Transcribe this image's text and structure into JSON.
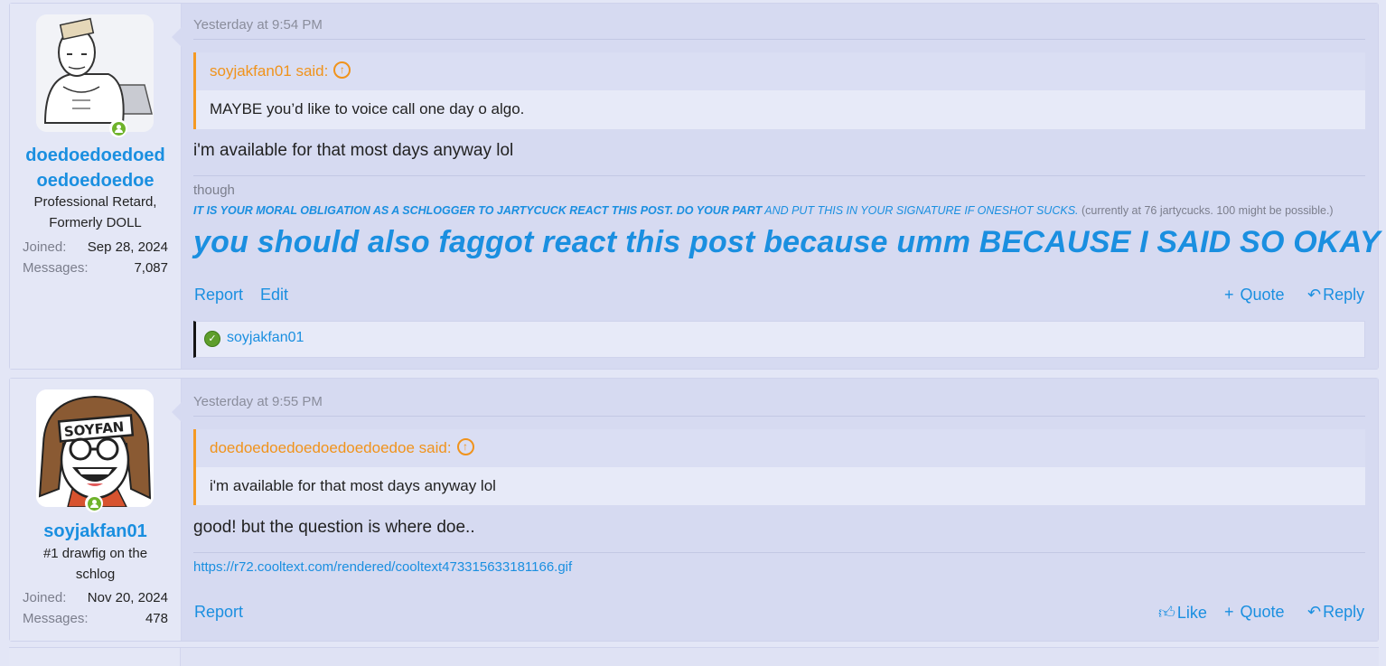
{
  "posts": [
    {
      "username_line1": "doedoedoedoed",
      "username_line2": "oedoedoedoe",
      "user_title_line1": "Professional Retard,",
      "user_title_line2": "Formerly DOLL",
      "joined_label": "Joined:",
      "joined_value": "Sep 28, 2024",
      "messages_label": "Messages:",
      "messages_value": "7,087",
      "date": "Yesterday at 9:54 PM",
      "quote_author": "soyjakfan01 said:",
      "quote_text": "MAYBE you’d like to voice call one day o algo.",
      "body": "i'm available for that most days anyway lol",
      "sig_small": "though",
      "sig_line_bold": "IT IS YOUR MORAL OBLIGATION AS A SCHLOGGER TO JARTYCUCK REACT THIS POST. DO YOUR PART",
      "sig_line_rest": "AND PUT THIS IN YOUR SIGNATURE IF ONESHOT SUCKS.",
      "sig_line_gray": "(currently at 76 jartycucks. 100 might be possible.)",
      "sig_big": "you should also faggot react this post because umm BECAUSE I SAID SO OKAY",
      "actions_left": [
        "Report",
        "Edit"
      ],
      "quote_label": "Quote",
      "reply_label": "Reply",
      "reaction_user": "soyjakfan01"
    },
    {
      "username_line1": "soyjakfan01",
      "user_title_line1": "#1 drawfig on the",
      "user_title_line2": "schlog",
      "joined_label": "Joined:",
      "joined_value": "Nov 20, 2024",
      "messages_label": "Messages:",
      "messages_value": "478",
      "date": "Yesterday at 9:55 PM",
      "quote_author": "doedoedoedoedoedoedoedoe said:",
      "quote_text": "i'm available for that most days anyway lol",
      "body": "good! but the question is where doe..",
      "link": "https://r72.cooltext.com/rendered/cooltext473315633181166.gif",
      "actions_left": [
        "Report"
      ],
      "like_label": "Like",
      "quote_label": "Quote",
      "reply_label": "Reply",
      "avatar_text": "SOYFAN"
    }
  ],
  "colors": {
    "link": "#1a8fe0",
    "quote_accent": "#f59a23",
    "online": "#6fb32b"
  }
}
